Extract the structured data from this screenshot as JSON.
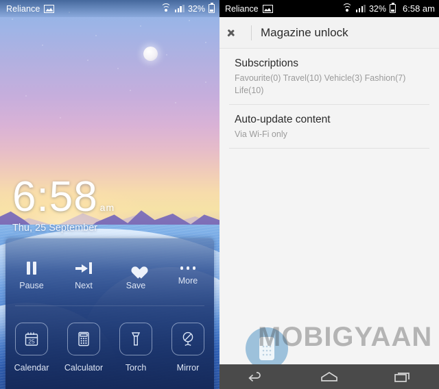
{
  "lockscreen": {
    "status_bar": {
      "carrier": "Reliance",
      "image_icon": "picture-icon",
      "wifi_icon": "wifi-icon",
      "signal_icon": "signal-bars-icon",
      "battery_percent": "32%",
      "battery_icon": "battery-icon"
    },
    "clock": {
      "time": "6:58",
      "meridiem": "am",
      "date": "Thu, 25 September"
    },
    "quick_panel": {
      "row1": [
        {
          "label": "Pause",
          "icon": "pause-icon"
        },
        {
          "label": "Next",
          "icon": "next-track-icon"
        },
        {
          "label": "Save",
          "icon": "heart-icon"
        },
        {
          "label": "More",
          "icon": "more-dots-icon"
        }
      ],
      "row2": [
        {
          "label": "Calendar",
          "icon": "calendar-icon",
          "day": "25"
        },
        {
          "label": "Calculator",
          "icon": "calculator-icon"
        },
        {
          "label": "Torch",
          "icon": "flashlight-icon"
        },
        {
          "label": "Mirror",
          "icon": "mirror-icon"
        }
      ]
    },
    "wallpaper": {
      "scene": "moonlit-sunset-mountains-dunes",
      "moon_icon": "moon-icon"
    }
  },
  "settings": {
    "status_bar": {
      "carrier": "Reliance",
      "image_icon": "picture-icon",
      "wifi_icon": "wifi-icon",
      "signal_icon": "signal-bars-icon",
      "battery_percent": "32%",
      "battery_icon": "battery-icon",
      "time": "6:58 am"
    },
    "header": {
      "back_icon": "back-chevron-icon",
      "title": "Magazine unlock"
    },
    "rows": [
      {
        "title": "Subscriptions",
        "subtitle": "Favourite(0) Travel(10) Vehicle(3) Fashion(7) Life(10)"
      },
      {
        "title": "Auto-update content",
        "subtitle": "Via Wi-Fi only"
      }
    ],
    "navbar": {
      "back_icon": "nav-back-icon",
      "home_icon": "nav-home-icon",
      "recents_icon": "nav-recents-icon"
    },
    "watermark": {
      "text": "MOBIGYAAN",
      "logo_icon": "mobigyaan-phone-logo"
    }
  },
  "colors": {
    "settings_bg": "#f4f4f4",
    "header_bg": "#f2f2f2",
    "navbar_bg": "#4a4a4a",
    "status_bar_dark": "#000000",
    "panel_blue": "#24407c",
    "title_text": "#2b2b2b",
    "subtitle_text": "#9a9a9a"
  }
}
